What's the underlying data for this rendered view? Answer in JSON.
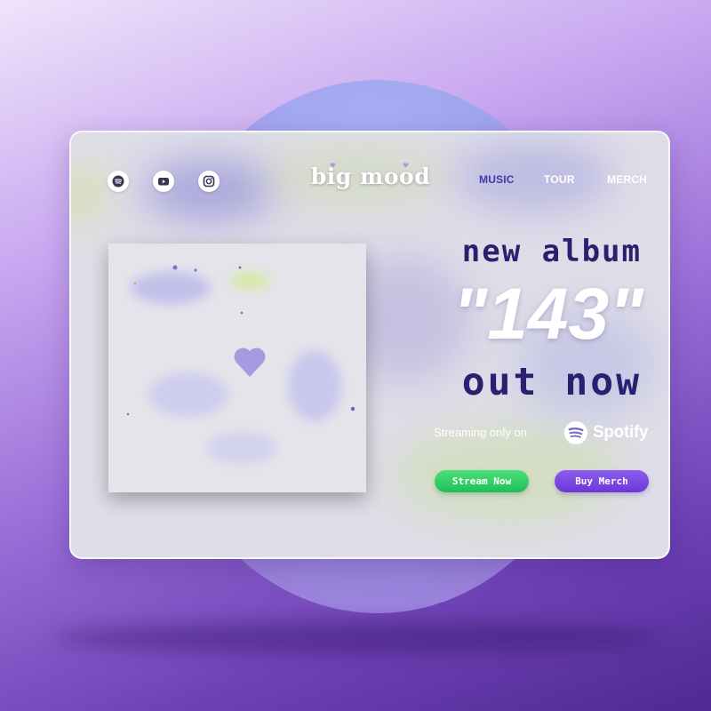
{
  "brand": {
    "name": "big mood"
  },
  "social": {
    "icons": [
      "spotify-icon",
      "youtube-icon",
      "instagram-icon"
    ]
  },
  "nav": {
    "items": [
      {
        "label": "MUSIC",
        "active": true
      },
      {
        "label": "TOUR",
        "active": false
      },
      {
        "label": "MERCH",
        "active": false
      }
    ]
  },
  "hero": {
    "line1": "new album",
    "title": "\"143\"",
    "line3": "out now",
    "streaming_label": "Streaming only on",
    "streaming_service": "Spotify"
  },
  "actions": {
    "stream_label": "Stream Now",
    "merch_label": "Buy Merch"
  },
  "colors": {
    "accent_dark": "#2b1f6f",
    "nav_active": "#3d3aa8",
    "stream_green": "#1fbf55",
    "merch_purple": "#6a38d6",
    "heart_lavender": "#a49be0"
  }
}
